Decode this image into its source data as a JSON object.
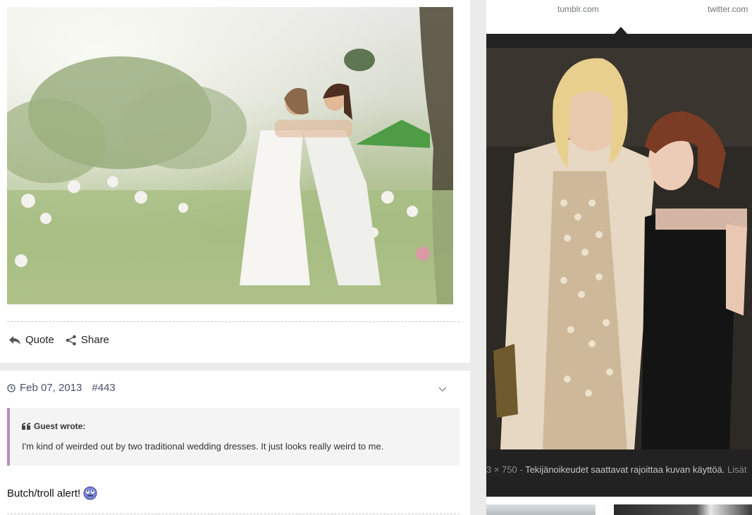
{
  "post": {
    "photo_alt": "wedding-photo",
    "actions": {
      "quote": "Quote",
      "share": "Share"
    }
  },
  "reply": {
    "date": "Feb 07, 2013",
    "post_number": "#443",
    "quote": {
      "author": "Guest wrote:",
      "text": "I'm kind of weirded out by two traditional wedding dresses. It just looks really weird to me."
    },
    "body": "Butch/troll alert!"
  },
  "viewer": {
    "sources": {
      "left": "tumblr.com",
      "right": "twitter.com"
    },
    "caption": {
      "dimensions": "3 × 750",
      "separator": " - ",
      "notice": "Tekijänoikeudet saattavat rajoittaa kuvan käyttöä.",
      "more": "Lisät"
    }
  },
  "colors": {
    "meta_text": "#49516b",
    "quote_border": "#b78fba",
    "viewer_bg": "#222222"
  }
}
